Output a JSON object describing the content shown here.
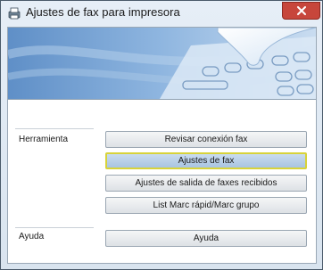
{
  "window": {
    "title": "Ajustes de fax para impresora"
  },
  "sections": [
    {
      "label": "Herramienta"
    },
    {
      "label": "Ayuda"
    }
  ],
  "buttons": {
    "check_connection": "Revisar conexión fax",
    "fax_settings": "Ajustes de fax",
    "received_output": "Ajustes de salida de faxes recibidos",
    "speed_dial": "List Marc rápid/Marc grupo",
    "help": "Ayuda"
  }
}
